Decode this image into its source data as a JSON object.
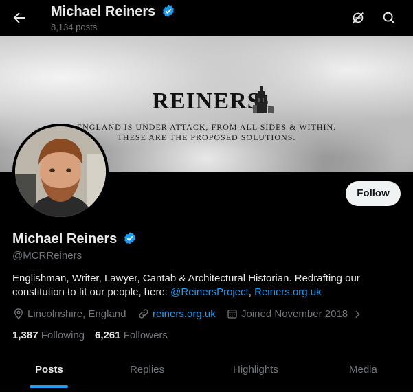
{
  "header": {
    "name": "Michael Reiners",
    "posts_count": "8,134 posts"
  },
  "banner": {
    "title": "REINERS",
    "line1": "ENGLAND IS UNDER ATTACK, FROM ALL SIDES & WITHIN.",
    "line2": "THESE ARE THE PROPOSED SOLUTIONS."
  },
  "profile": {
    "name": "Michael Reiners",
    "handle": "@MCRReiners",
    "bio_text": "Englishman, Writer, Lawyer, Cantab & Architectural Historian. Redrafting our constitution to fit our people, here: ",
    "bio_link1": "@ReinersProject",
    "bio_sep": ", ",
    "bio_link2": "Reiners.org.uk",
    "location": "Lincolnshire, England",
    "website": "reiners.org.uk",
    "joined": "Joined November 2018",
    "following_count": "1,387",
    "following_label": "Following",
    "followers_count": "6,261",
    "followers_label": "Followers",
    "follow_button": "Follow"
  },
  "tabs": [
    {
      "label": "Posts",
      "active": true
    },
    {
      "label": "Replies",
      "active": false
    },
    {
      "label": "Highlights",
      "active": false
    },
    {
      "label": "Media",
      "active": false
    }
  ],
  "colors": {
    "accent": "#1d9bf0",
    "background": "#000000",
    "text_secondary": "#71767b"
  },
  "icons": [
    "back-arrow-icon",
    "verified-badge-icon",
    "hide-reposts-icon",
    "search-icon",
    "location-icon",
    "link-icon",
    "calendar-icon",
    "chevron-right-icon"
  ]
}
